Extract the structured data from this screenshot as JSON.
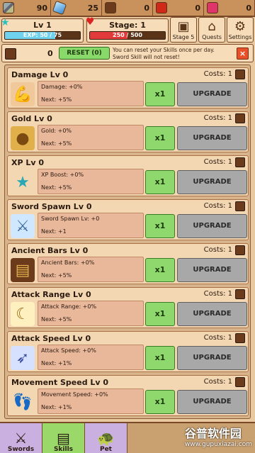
{
  "resources": [
    {
      "name": "sword-icon",
      "value": "90"
    },
    {
      "name": "gem-icon",
      "value": "25"
    },
    {
      "name": "book-icon",
      "value": "0"
    },
    {
      "name": "apple-icon",
      "value": "0"
    },
    {
      "name": "ruby-icon",
      "value": "0"
    }
  ],
  "level": {
    "title": "Lv 1",
    "exp_label": "EXP: 50 / 75",
    "exp_fraction": 0.667
  },
  "stage": {
    "title": "Stage: 1",
    "hp_label": "250 / 500",
    "hp_fraction": 0.5
  },
  "top_buttons": {
    "stage": "Stage 5",
    "quests": "Quests",
    "settings": "Settings"
  },
  "reset": {
    "count": "0",
    "button": "RESET (0)",
    "note_line1": "You can reset your Skills once per day.",
    "note_line2": "Sword Skill will not reset!",
    "close": "×"
  },
  "skills": [
    {
      "title": "Damage Lv 0",
      "cost": "Costs: 1",
      "stat": "Damage: +0%",
      "next": "Next: +5%",
      "x1": "x1",
      "upgrade": "UPGRADE",
      "icon": "muscle-icon"
    },
    {
      "title": "Gold Lv 0",
      "cost": "Costs: 1",
      "stat": "Gold: +0%",
      "next": "Next: +5%",
      "x1": "x1",
      "upgrade": "UPGRADE",
      "icon": "coin-icon"
    },
    {
      "title": "XP Lv 0",
      "cost": "Costs: 1",
      "stat": "XP Boost: +0%",
      "next": "Next: +5%",
      "x1": "x1",
      "upgrade": "UPGRADE",
      "icon": "star-icon"
    },
    {
      "title": "Sword Spawn Lv 0",
      "cost": "Costs: 1",
      "stat": "Sword Spawn Lv: +0",
      "next": "Next: +1",
      "x1": "x1",
      "upgrade": "UPGRADE",
      "icon": "sword-spawn-icon"
    },
    {
      "title": "Ancient Bars Lv 0",
      "cost": "Costs: 1",
      "stat": "Ancient Bars: +0%",
      "next": "Next: +5%",
      "x1": "x1",
      "upgrade": "UPGRADE",
      "icon": "bars-icon"
    },
    {
      "title": "Attack Range Lv 0",
      "cost": "Costs: 1",
      "stat": "Attack Range: +0%",
      "next": "Next: +5%",
      "x1": "x1",
      "upgrade": "UPGRADE",
      "icon": "range-icon"
    },
    {
      "title": "Attack Speed Lv 0",
      "cost": "Costs: 1",
      "stat": "Attack Speed: +0%",
      "next": "Next: +1%",
      "x1": "x1",
      "upgrade": "UPGRADE",
      "icon": "speed-icon"
    },
    {
      "title": "Movement Speed Lv 0",
      "cost": "Costs: 1",
      "stat": "Movement Speed: +0%",
      "next": "Next: +1%",
      "x1": "x1",
      "upgrade": "UPGRADE",
      "icon": "foot-icon"
    }
  ],
  "nav": {
    "swords": "Swords",
    "skills": "Skills",
    "pet": "Pet"
  },
  "watermark": {
    "line1": "谷普软件园",
    "line2": "www.gupuxiazai.com"
  }
}
